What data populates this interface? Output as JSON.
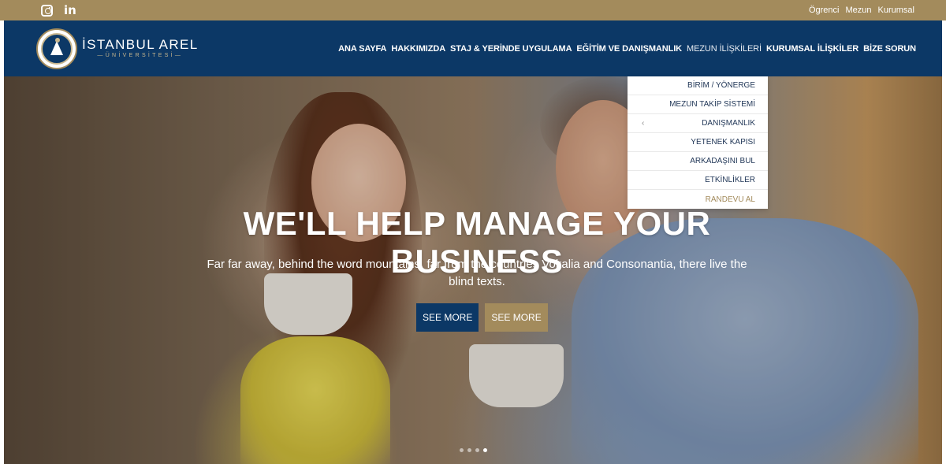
{
  "topbar": {
    "social": [
      {
        "icon": "instagram-icon"
      },
      {
        "icon": "linkedin-icon",
        "text": "in"
      }
    ],
    "links": [
      "Ögrenci",
      "Mezun",
      "Kurumsal"
    ]
  },
  "header": {
    "logo": {
      "name": "İSTANBUL AREL",
      "sub": "—ÜNİVERSİTESİ—"
    },
    "nav": [
      "ANA SAYFA",
      "HAKKIMIZDA",
      "STAJ & YERİNDE UYGULAMA",
      "EĞİTİM VE DANIŞMANLIK",
      "MEZUN İLİŞKİLERİ",
      "KURUMSAL İLİŞKİLER",
      "BİZE SORUN"
    ],
    "active_index": 4
  },
  "dropdown": {
    "items": [
      "BİRİM / YÖNERGE",
      "MEZUN TAKİP SİSTEMİ",
      "DANIŞMANLIK",
      "YETENEK KAPISI",
      "ARKADAŞINI BUL",
      "ETKİNLİKLER",
      "RANDEVU AL"
    ],
    "submenu_chevron": "‹"
  },
  "hero": {
    "title": "WE'LL HELP MANAGE YOUR BUSINESS",
    "subtitle": "Far far away, behind the word mountains, far from the countries Vokalia and Consonantia, there live the blind texts.",
    "buttons": [
      "SEE MORE",
      "SEE MORE"
    ],
    "slide_count": 4,
    "active_slide": 4
  },
  "colors": {
    "gold": "#a38b5c",
    "navy": "#0c3866"
  }
}
